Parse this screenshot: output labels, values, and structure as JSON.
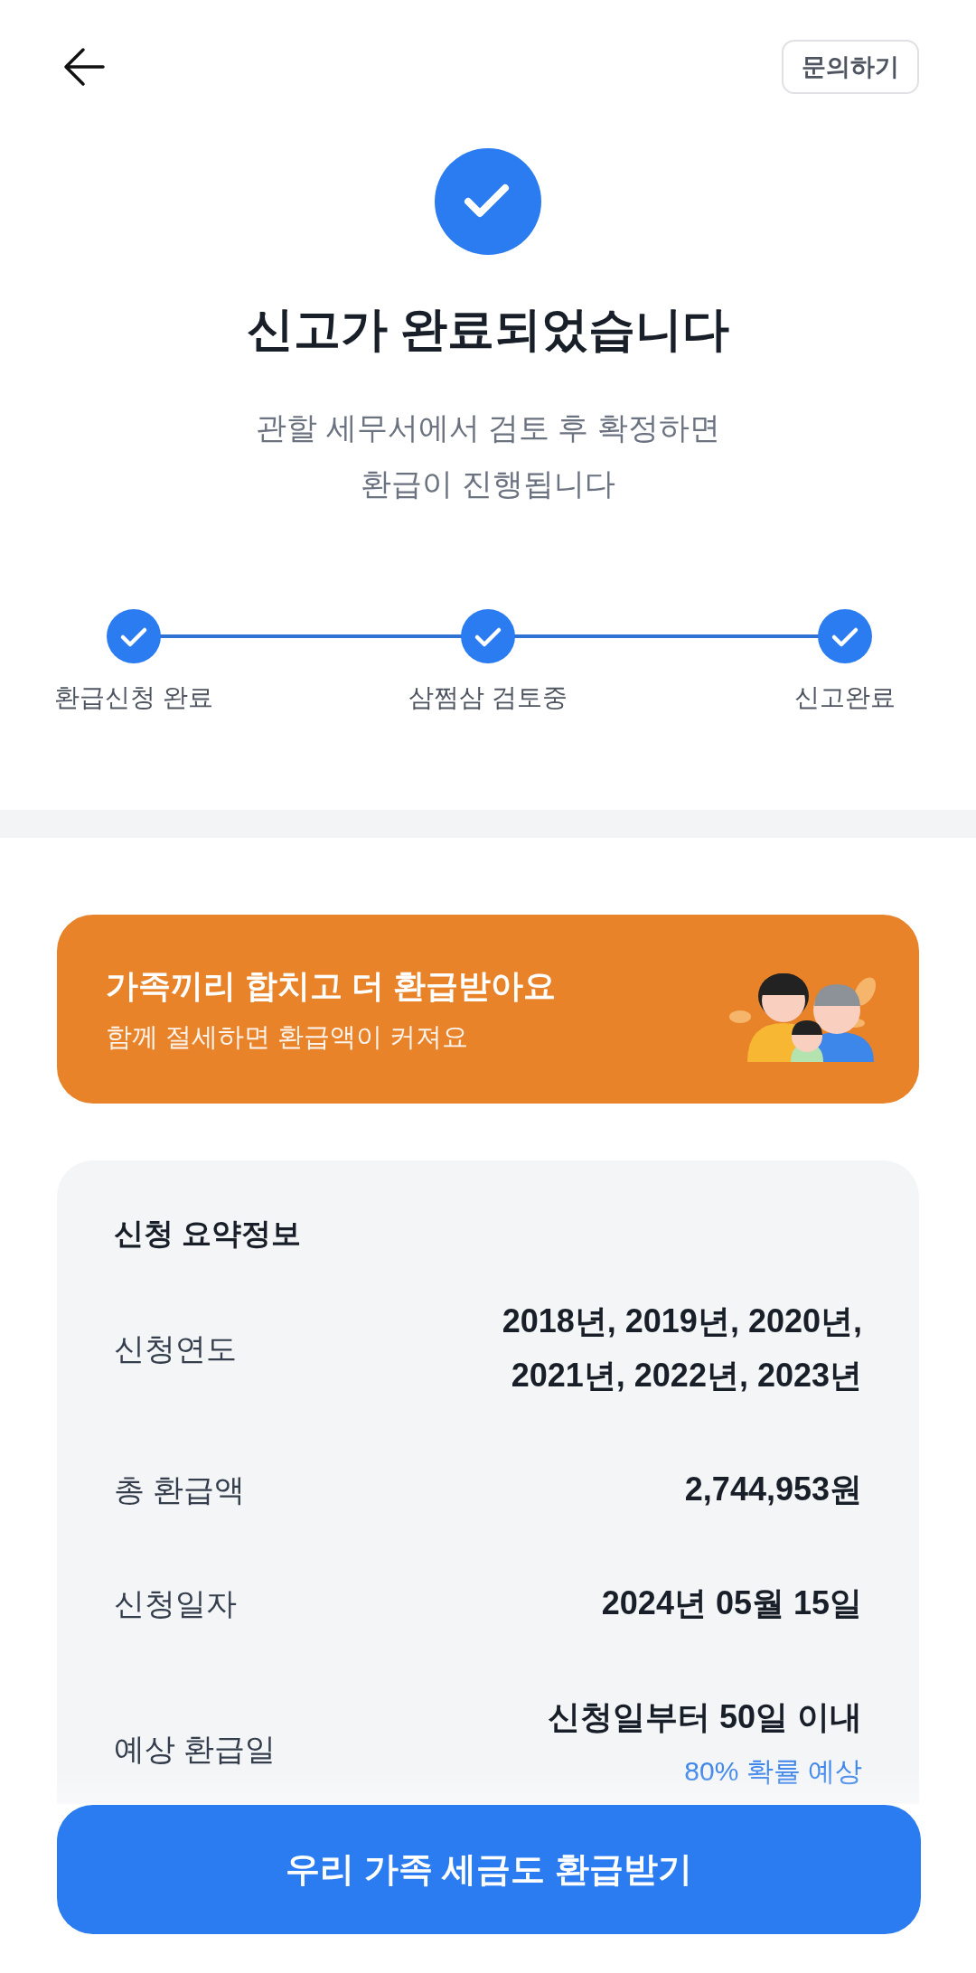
{
  "header": {
    "help_button": "문의하기"
  },
  "status": {
    "title": "신고가 완료되었습니다",
    "message_lines": [
      "관할 세무서에서 검토 후 확정하면",
      "환급이 진행됩니다"
    ]
  },
  "steps": [
    {
      "label": "환급신청 완료",
      "done": true
    },
    {
      "label": "삼쩜삼 검토중",
      "done": true
    },
    {
      "label": "신고완료",
      "done": true
    }
  ],
  "banner": {
    "title": "가족끼리 합치고 더 환급받아요",
    "subtitle": "함께 절세하면 환급액이 커져요"
  },
  "summary": {
    "title": "신청 요약정보",
    "rows": [
      {
        "label": "신청연도",
        "value_lines": [
          "2018년, 2019년, 2020년,",
          "2021년, 2022년, 2023년"
        ]
      },
      {
        "label": "총 환급액",
        "value_lines": [
          "2,744,953원"
        ]
      },
      {
        "label": "신청일자",
        "value_lines": [
          "2024년 05월 15일"
        ]
      },
      {
        "label": "예상 환급일",
        "value_lines": [
          "신청일부터 50일 이내"
        ],
        "note": "80% 확률 예상"
      }
    ]
  },
  "cta_button": "우리 가족 세금도 환급받기"
}
